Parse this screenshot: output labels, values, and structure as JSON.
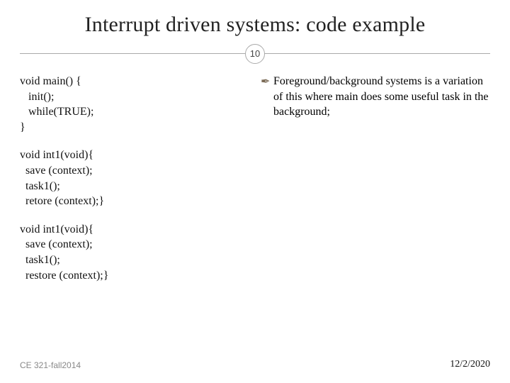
{
  "slide": {
    "title": "Interrupt driven systems: code example",
    "number": "10",
    "footer_left": "CE 321-fall2014",
    "footer_right": "12/2/2020"
  },
  "code": {
    "block1": {
      "l1": "void main() {",
      "l2": "   init();",
      "l3": "   while(TRUE);",
      "l4": "}"
    },
    "block2": {
      "l1": "void int1(void){",
      "l2": "  save (context);",
      "l3": "  task1();",
      "l4": "  retore (context);}"
    },
    "block3": {
      "l1": "void int1(void){",
      "l2": "  save (context);",
      "l3": "  task1();",
      "l4": "  restore (context);}"
    }
  },
  "bullets": {
    "b1": "Foreground/background systems is a variation of this where main does some useful task in the background;"
  },
  "icons": {
    "bullet_marker": "✒"
  }
}
